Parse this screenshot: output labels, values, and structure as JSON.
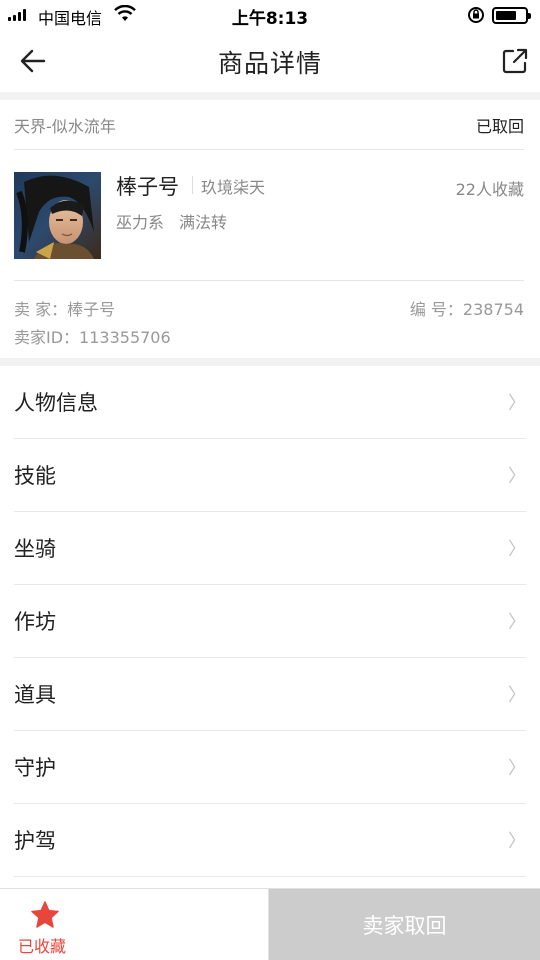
{
  "status_bar": {
    "carrier": "中国电信",
    "time": "上午8:13"
  },
  "nav": {
    "title": "商品详情"
  },
  "product": {
    "server": "天界-似水流年",
    "status": "已取回",
    "role_name": "棒子号",
    "role_server": "玖境柒天",
    "collect_count": "22人收藏",
    "tags": [
      "巫力系",
      "满法转"
    ],
    "seller": "卖 家：棒子号",
    "item_no": "编 号：238754",
    "seller_id": "卖家ID：113355706"
  },
  "menu": {
    "items": [
      {
        "label": "人物信息"
      },
      {
        "label": "技能"
      },
      {
        "label": "坐骑"
      },
      {
        "label": "作坊"
      },
      {
        "label": "道具"
      },
      {
        "label": "守护"
      },
      {
        "label": "护驾"
      }
    ]
  },
  "bottom": {
    "favorite_label": "已收藏",
    "recall_label": "卖家取回"
  },
  "colors": {
    "accent_red": "#e8463d",
    "disabled_button": "#cccccc"
  }
}
